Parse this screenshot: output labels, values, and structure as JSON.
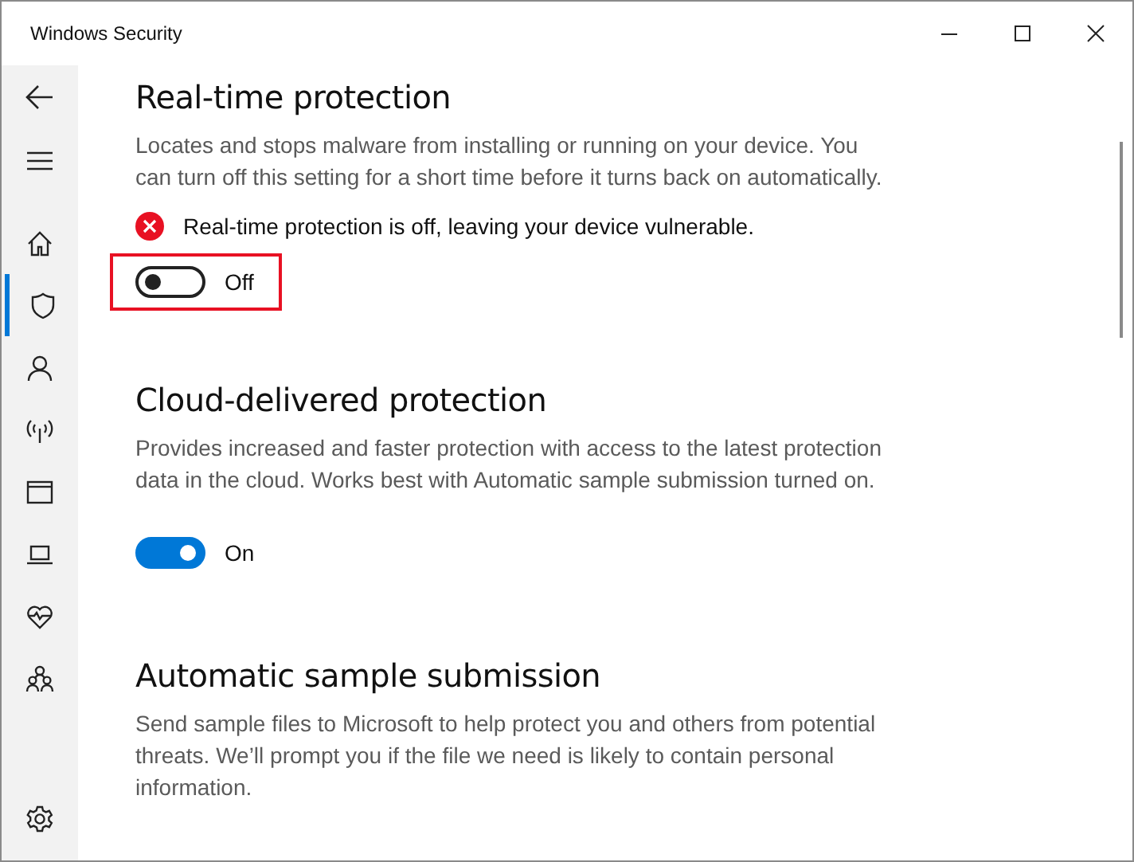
{
  "window": {
    "title": "Windows Security"
  },
  "sidebar": {
    "items": [
      {
        "kind": "home",
        "selected": false
      },
      {
        "kind": "shield",
        "selected": true
      },
      {
        "kind": "person",
        "selected": false
      },
      {
        "kind": "antenna",
        "selected": false
      },
      {
        "kind": "browser",
        "selected": false
      },
      {
        "kind": "laptop",
        "selected": false
      },
      {
        "kind": "heart",
        "selected": false
      },
      {
        "kind": "family",
        "selected": false
      }
    ]
  },
  "sections": [
    {
      "title": "Real-time protection",
      "description": "Locates and stops malware from installing or running on your device. You can turn off this setting for a short time before it turns back on automatically.",
      "alert": "Real-time protection is off, leaving your device vulnerable.",
      "toggle": {
        "on": false,
        "label": "Off",
        "highlighted": true
      }
    },
    {
      "title": "Cloud-delivered protection",
      "description": "Provides increased and faster protection with access to the latest protection data in the cloud. Works best with Automatic sample submission turned on.",
      "toggle": {
        "on": true,
        "label": "On",
        "highlighted": false
      }
    },
    {
      "title": "Automatic sample submission",
      "description": "Send sample files to Microsoft to help protect you and others from potential threats. We’ll prompt you if the file we need is likely to contain personal information."
    }
  ]
}
